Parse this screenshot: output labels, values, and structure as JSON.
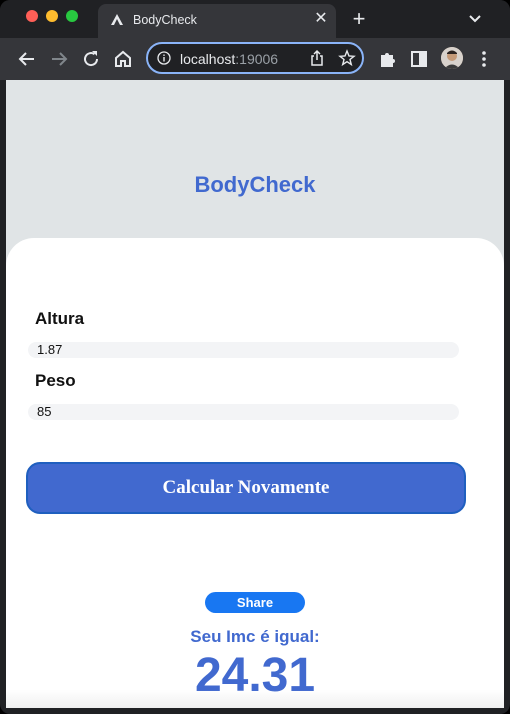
{
  "browser": {
    "tab_title": "BodyCheck",
    "url_host": "localhost",
    "url_port": ":19006",
    "icons": {
      "close": "close-icon",
      "new_tab": "plus-icon",
      "back": "arrow-left-icon",
      "forward": "arrow-right-icon",
      "reload": "reload-icon",
      "home": "home-icon",
      "info": "info-icon",
      "share": "share-icon",
      "bookmark": "star-icon",
      "extensions": "puzzle-icon",
      "sidepanel": "sidepanel-icon",
      "menu": "kebab-menu-icon"
    },
    "symbols": {
      "close": "✕",
      "new_tab": "+"
    }
  },
  "app": {
    "title": "BodyCheck",
    "accent_color": "#4169cf",
    "fields": [
      {
        "label": "Altura",
        "value": "1.87"
      },
      {
        "label": "Peso",
        "value": "85"
      }
    ],
    "calculate_button": "Calcular Novamente",
    "share_button": "Share",
    "result_label": "Seu Imc é igual:",
    "result_value": "24.31"
  }
}
